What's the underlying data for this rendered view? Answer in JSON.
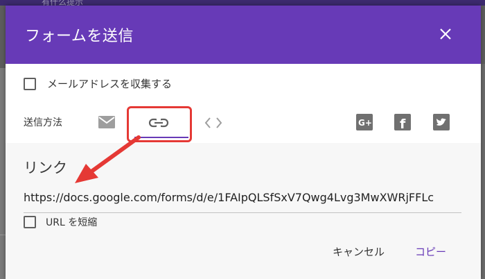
{
  "background": {
    "top_text": "有什么提示"
  },
  "dialog": {
    "title": "フォームを送信",
    "collect_email_label": "メールアドレスを収集する",
    "send_method_label": "送信方法",
    "link_section": {
      "heading": "リンク",
      "url": "https://docs.google.com/forms/d/e/1FAIpQLSfSxV7Qwg4Lvg3MwXWRjFFLc",
      "shorten_label": "URL を短縮"
    },
    "buttons": {
      "cancel": "キャンセル",
      "copy": "コピー"
    },
    "icons": [
      "close-icon",
      "email-icon",
      "link-icon",
      "embed-code-icon",
      "google-plus-icon",
      "facebook-icon",
      "twitter-icon"
    ]
  },
  "colors": {
    "header": "#673ab7",
    "accent": "#673ab7",
    "highlight": "#e53935",
    "icon_gray": "#9e9e9e",
    "social_gray": "#707070"
  }
}
